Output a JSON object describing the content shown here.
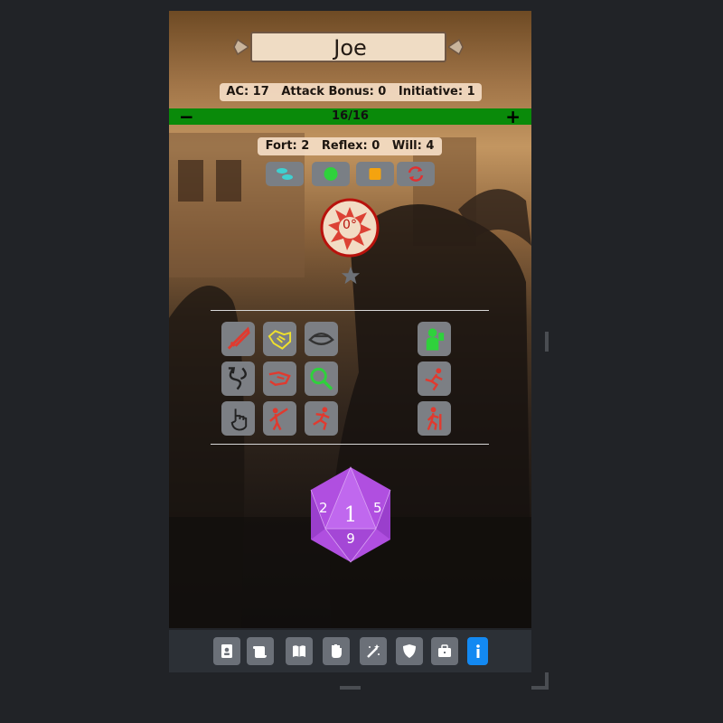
{
  "character": {
    "name": "Joe"
  },
  "stats": {
    "text": "AC: 17   Attack Bonus: 0   Initiative: 1"
  },
  "hp": {
    "minus": "−",
    "value": "16/16",
    "plus": "+",
    "color": "#0a8a0a"
  },
  "saves": {
    "text": "Fort: 2   Reflex: 0   Will: 4"
  },
  "conditions": [
    {
      "icon": "footprints-icon",
      "color": "#3fd0d0"
    },
    {
      "icon": "green-circle-icon",
      "color": "#2fd13c"
    },
    {
      "icon": "orange-square-icon",
      "color": "#f4a30f"
    },
    {
      "icon": "cycle-arrows-icon",
      "color": "#e03030"
    }
  ],
  "target": {
    "value": "0°",
    "icon": "spiral-target-icon"
  },
  "star": {
    "icon": "star-icon"
  },
  "actions": [
    {
      "icon": "sword-icon",
      "color": "#e03a2f"
    },
    {
      "icon": "handshake-icon",
      "color": "#f0e12c"
    },
    {
      "icon": "eye-icon",
      "color": "#333333"
    },
    {
      "icon": "swap-arrows-icon",
      "color": "#222222"
    },
    {
      "icon": "grapple-icon",
      "color": "#e03a2f"
    },
    {
      "icon": "magnifier-icon",
      "color": "#2fd13c"
    },
    {
      "icon": "pointing-hand-icon",
      "color": "#222222"
    },
    {
      "icon": "throw-icon",
      "color": "#e03a2f"
    },
    {
      "icon": "run-icon",
      "color": "#e03a2f"
    },
    {
      "icon": "drink-icon",
      "color": "#2fd13c"
    },
    {
      "icon": "fall-icon",
      "color": "#e03a2f"
    },
    {
      "icon": "walk-icon",
      "color": "#e03a2f"
    }
  ],
  "dice": {
    "type": "d20",
    "result": "1",
    "faces": [
      "2",
      "5",
      "9"
    ],
    "color": "#b04fe0"
  },
  "toolbar": [
    {
      "icon": "character-card-icon"
    },
    {
      "icon": "scroll-icon"
    },
    {
      "icon": "book-icon"
    },
    {
      "icon": "fist-icon"
    },
    {
      "icon": "magic-wand-icon"
    },
    {
      "icon": "shield-icon"
    },
    {
      "icon": "briefcase-icon"
    },
    {
      "icon": "info-icon",
      "active": true,
      "color": "#1389f2"
    }
  ]
}
